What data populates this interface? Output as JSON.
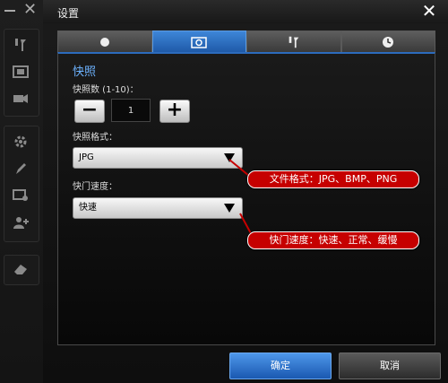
{
  "dialog": {
    "title": "设置"
  },
  "tabs": [
    {
      "icon": "dot-icon"
    },
    {
      "icon": "camera-icon",
      "active": true
    },
    {
      "icon": "tools-icon"
    },
    {
      "icon": "clock-icon"
    }
  ],
  "snapshot": {
    "section_title": "快照",
    "count_label": "快照数 (1-10)：",
    "count_value": "1",
    "minus": "−",
    "plus": "+",
    "format_label": "快照格式：",
    "format_value": "JPG",
    "shutter_label": "快门速度：",
    "shutter_value": "快速"
  },
  "annotations": {
    "format_note": "文件格式：JPG、BMP、PNG",
    "shutter_note": "快门速度：快速、正常、缓慢",
    "color": "#c60000"
  },
  "buttons": {
    "ok": "确定",
    "cancel": "取消"
  },
  "sidebar": {
    "icons": [
      "minimize-icon",
      "close-icon",
      "tools-icon",
      "screen-icon",
      "camera-icon",
      "gear-icon",
      "pen-icon",
      "screen-settings-icon",
      "user-add-icon",
      "eraser-icon"
    ]
  },
  "colors": {
    "accent": "#2c6bbd",
    "section_title": "#6db3ff"
  }
}
